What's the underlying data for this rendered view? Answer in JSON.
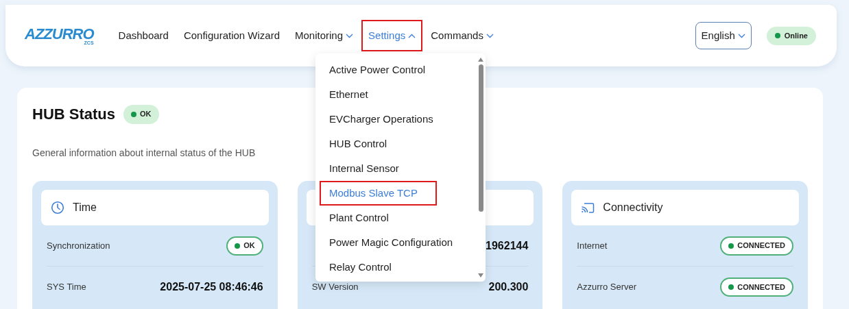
{
  "logo": {
    "name": "AZZURRO",
    "sub": "ZCS"
  },
  "nav": [
    {
      "label": "Dashboard",
      "selected": false,
      "highlighted": false
    },
    {
      "label": "Configuration Wizard",
      "selected": false,
      "highlighted": false
    },
    {
      "label": "Monitoring",
      "expanded": false,
      "selected": false,
      "highlighted": false
    },
    {
      "label": "Settings",
      "expanded": true,
      "selected": true,
      "highlighted": true
    },
    {
      "label": "Commands",
      "expanded": false,
      "selected": false,
      "highlighted": false
    }
  ],
  "language": {
    "value": "English"
  },
  "connection": {
    "label": "Online"
  },
  "settings_menu": [
    {
      "label": "Active Power Control",
      "selected": false,
      "highlighted": false
    },
    {
      "label": "Ethernet",
      "selected": false,
      "highlighted": false
    },
    {
      "label": "EVCharger Operations",
      "selected": false,
      "highlighted": false
    },
    {
      "label": "HUB Control",
      "selected": false,
      "highlighted": false
    },
    {
      "label": "Internal Sensor",
      "selected": false,
      "highlighted": false
    },
    {
      "label": "Modbus Slave TCP",
      "selected": true,
      "highlighted": true
    },
    {
      "label": "Plant Control",
      "selected": false,
      "highlighted": false
    },
    {
      "label": "Power Magic Configuration",
      "selected": false,
      "highlighted": false
    },
    {
      "label": "Relay Control",
      "selected": false,
      "highlighted": false
    }
  ],
  "hub_status": {
    "title": "HUB Status",
    "badge": "OK",
    "description": "General information about internal status of the HUB"
  },
  "panels": [
    {
      "kind": "time",
      "title": "Time",
      "rows": [
        {
          "label": "Synchronization",
          "kind": "badge",
          "value": "OK"
        },
        {
          "label": "SYS Time",
          "kind": "text",
          "value": "2025-07-25 08:46:46"
        }
      ]
    },
    {
      "kind": "hidden",
      "rows": [
        {
          "kind": "text",
          "value": "1962144"
        },
        {
          "label": "SW Version",
          "kind": "text",
          "value": "200.300"
        }
      ]
    },
    {
      "kind": "connectivity",
      "title": "Connectivity",
      "rows": [
        {
          "label": "Internet",
          "kind": "badge",
          "value": "CONNECTED"
        },
        {
          "label": "Azzurro Server",
          "kind": "badge",
          "value": "CONNECTED"
        }
      ]
    }
  ]
}
